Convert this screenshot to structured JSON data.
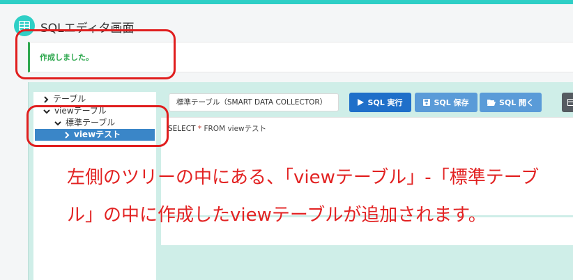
{
  "header": {
    "title": "SQLエディタ画面",
    "icon": "table-grid-icon"
  },
  "alert": {
    "message": "作成しました。"
  },
  "tree": {
    "items": [
      {
        "label": "テーブル",
        "expanded": false
      },
      {
        "label": "viewテーブル",
        "expanded": true
      },
      {
        "label": "標準テーブル",
        "expanded": true
      },
      {
        "label": "viewテスト",
        "selected": true
      }
    ]
  },
  "toolbar": {
    "db_select_value": "標準テーブル（SMART DATA COLLECTOR）",
    "run_label": "SQL 実行",
    "save_label": "SQL 保存",
    "open_label": "SQL 開く"
  },
  "editor": {
    "sql_select": "SELECT",
    "sql_star": "*",
    "sql_rest": "FROM viewテスト"
  },
  "annotation": {
    "text": "左側のツリーの中にある、「viewテーブル」-「標準テーブル」の中に作成したviewテーブルが追加されます。"
  },
  "colors": {
    "accent": "#2ecfc6",
    "success": "#2fa84f",
    "primary_button": "#1f6fc9",
    "secondary_button": "#5a9bd8",
    "annotation_red": "#e22222"
  }
}
